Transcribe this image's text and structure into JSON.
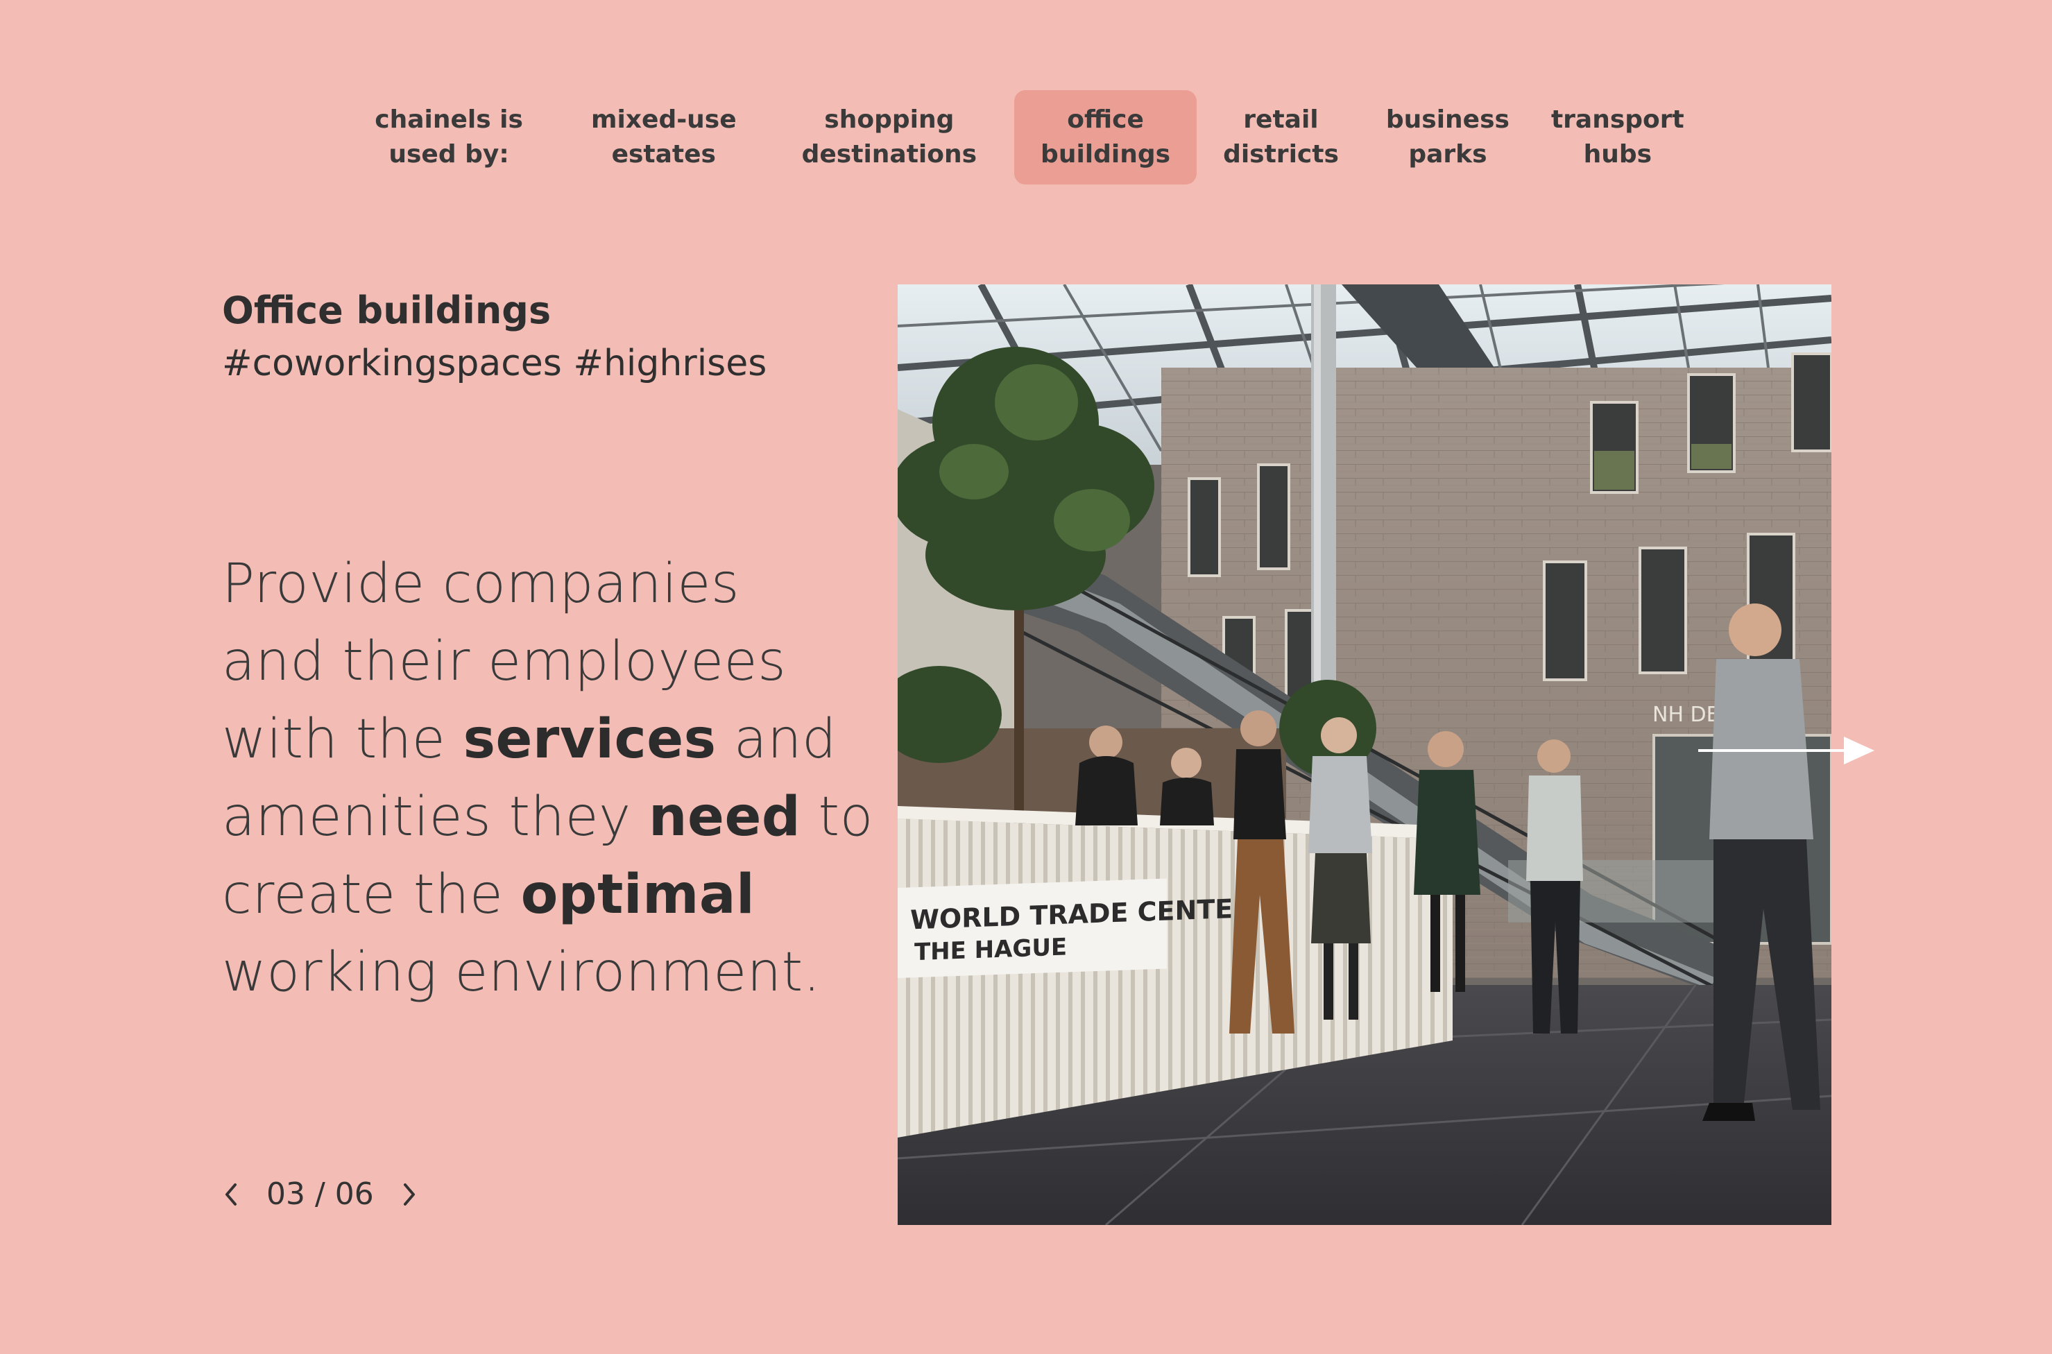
{
  "nav": {
    "label": "chainels is\nused by:",
    "items": [
      {
        "label": "mixed-use\nestates",
        "active": false
      },
      {
        "label": "shopping\ndestinations",
        "active": false
      },
      {
        "label": "office\nbuildings",
        "active": true
      },
      {
        "label": "retail\ndistricts",
        "active": false
      },
      {
        "label": "business\nparks",
        "active": false
      },
      {
        "label": "transport\nhubs",
        "active": false
      }
    ]
  },
  "slide": {
    "title": "Office buildings",
    "tags": "#coworkingspaces #highrises",
    "statement": {
      "line1": "Provide companies",
      "line2": "and their employees",
      "line3_pre": "with the ",
      "line3_bold": "services",
      "line3_post": " and",
      "line4_pre": "amenities they ",
      "line4_bold": "need",
      "line4_post": " to",
      "line5_pre": "create the ",
      "line5_bold": "optimal",
      "line6": "working environment."
    },
    "pager": {
      "current": "03",
      "separator": "/",
      "total": "06",
      "text": "03 / 06"
    },
    "photo": {
      "sign_line1": "WORLD TRADE CENTER",
      "sign_line2": "THE HAGUE",
      "hotel_sign": "NH DEN"
    }
  },
  "icons": {
    "prev": "chevron-left-icon",
    "next": "chevron-right-icon",
    "next_arrow": "arrow-right-icon"
  },
  "colors": {
    "background": "#f3bdb5",
    "active_tab": "#eb9f94",
    "text": "#333333"
  }
}
